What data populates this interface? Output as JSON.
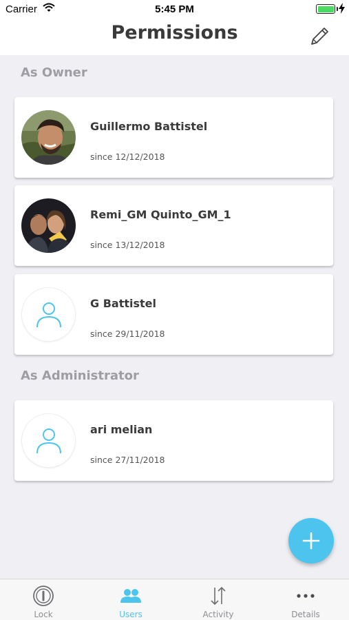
{
  "status_bar": {
    "carrier": "Carrier",
    "time": "5:45 PM",
    "battery_level": 1.0
  },
  "header": {
    "title": "Permissions",
    "edit_icon": "pencil-icon"
  },
  "sections": [
    {
      "heading": "As Owner",
      "users": [
        {
          "name": "Guillermo Battistel",
          "since": "since 12/12/2018",
          "avatar": "photo"
        },
        {
          "name": "Remi_GM Quinto_GM_1",
          "since": "since 13/12/2018",
          "avatar": "photo"
        },
        {
          "name": "G Battistel",
          "since": "since 29/11/2018",
          "avatar": "person-placeholder-icon"
        }
      ]
    },
    {
      "heading": "As Administrator",
      "users": [
        {
          "name": "ari melian",
          "since": "since 27/11/2018",
          "avatar": "person-placeholder-icon"
        }
      ]
    }
  ],
  "fab": {
    "icon": "plus-icon"
  },
  "tab_bar": {
    "tabs": [
      {
        "label": "Lock",
        "icon": "lock-icon",
        "active": false
      },
      {
        "label": "Users",
        "icon": "users-icon",
        "active": true
      },
      {
        "label": "Activity",
        "icon": "activity-arrows-icon",
        "active": false
      },
      {
        "label": "Details",
        "icon": "more-dots-icon",
        "active": false
      }
    ]
  },
  "colors": {
    "accent": "#4cc4ee",
    "background": "#efeff4",
    "section_heading": "#9d9da3",
    "battery": "#4cd964"
  }
}
